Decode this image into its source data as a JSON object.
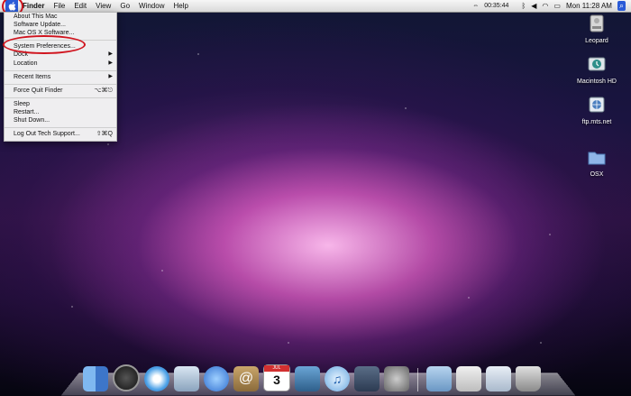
{
  "menubar": {
    "app_name": "Finder",
    "menus": [
      "File",
      "Edit",
      "View",
      "Go",
      "Window",
      "Help"
    ],
    "timer": "00:35:44",
    "clock": "Mon 11:28 AM"
  },
  "apple_menu": {
    "items": [
      {
        "label": "About This Mac",
        "shortcut": ""
      },
      {
        "label": "Software Update...",
        "shortcut": ""
      },
      {
        "label": "Mac OS X Software...",
        "shortcut": ""
      },
      {
        "label": "System Preferences...",
        "shortcut": ""
      },
      {
        "label": "Dock",
        "shortcut": "▶"
      },
      {
        "label": "Location",
        "shortcut": "▶"
      },
      {
        "label": "Recent Items",
        "shortcut": "▶"
      },
      {
        "label": "Force Quit Finder",
        "shortcut": "⌥⌘⎋"
      },
      {
        "label": "Sleep",
        "shortcut": ""
      },
      {
        "label": "Restart...",
        "shortcut": ""
      },
      {
        "label": "Shut Down...",
        "shortcut": ""
      },
      {
        "label": "Log Out Tech Support...",
        "shortcut": "⇧⌘Q"
      }
    ]
  },
  "desktop_icons": [
    {
      "label": "Leopard",
      "icon": "hard-drive-icon"
    },
    {
      "label": "Macintosh HD",
      "icon": "time-machine-drive-icon"
    },
    {
      "label": "ftp.mts.net",
      "icon": "network-drive-icon"
    },
    {
      "label": "OSX",
      "icon": "folder-icon"
    }
  ],
  "dock": {
    "apps": [
      "finder",
      "dashboard",
      "safari",
      "mail",
      "ichat",
      "address-book",
      "ical",
      "iphoto",
      "itunes",
      "spaces",
      "system-preferences"
    ],
    "ical_month": "JUL",
    "ical_day": "3",
    "right": [
      "applications-folder",
      "documents",
      "downloads",
      "trash"
    ]
  },
  "colors": {
    "highlight_ring": "#d0141e",
    "selection_blue": "#2a5bd7"
  }
}
